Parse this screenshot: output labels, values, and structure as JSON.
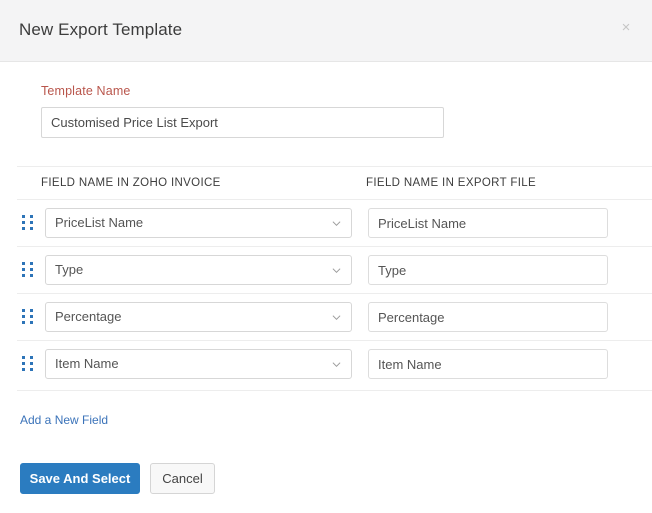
{
  "dialog": {
    "title": "New Export Template",
    "close_icon": "close-icon",
    "close_glyph": "×"
  },
  "template_name": {
    "label": "Template Name",
    "value": "Customised Price List Export",
    "placeholder": "Template Name"
  },
  "table": {
    "headers": {
      "source": "FIELD NAME IN ZOHO INVOICE",
      "target": "FIELD NAME IN EXPORT FILE"
    },
    "rows": [
      {
        "drag_icon": "drag-handle-icon",
        "source_field": "PriceList Name",
        "export_field": "PriceList Name",
        "export_placeholder": "PriceList Name",
        "chevron_icon": "chevron-down-icon"
      },
      {
        "drag_icon": "drag-handle-icon",
        "source_field": "Type",
        "export_field": "Type",
        "export_placeholder": "Type",
        "chevron_icon": "chevron-down-icon"
      },
      {
        "drag_icon": "drag-handle-icon",
        "source_field": "Percentage",
        "export_field": "Percentage",
        "export_placeholder": "Percentage",
        "chevron_icon": "chevron-down-icon"
      },
      {
        "drag_icon": "drag-handle-icon",
        "source_field": "Item Name",
        "export_field": "Item Name",
        "export_placeholder": "Item Name",
        "chevron_icon": "chevron-down-icon"
      }
    ]
  },
  "footer": {
    "add_field_link": "Add a New Field",
    "save_label": "Save And Select",
    "cancel_label": "Cancel"
  },
  "colors": {
    "accent_blue": "#2b7cc0",
    "link_blue": "#3b73b9",
    "label_red": "#b9564c",
    "header_bg": "#f4f4f5",
    "border_gray": "#d7d7d7",
    "divider_gray": "#ededed"
  }
}
